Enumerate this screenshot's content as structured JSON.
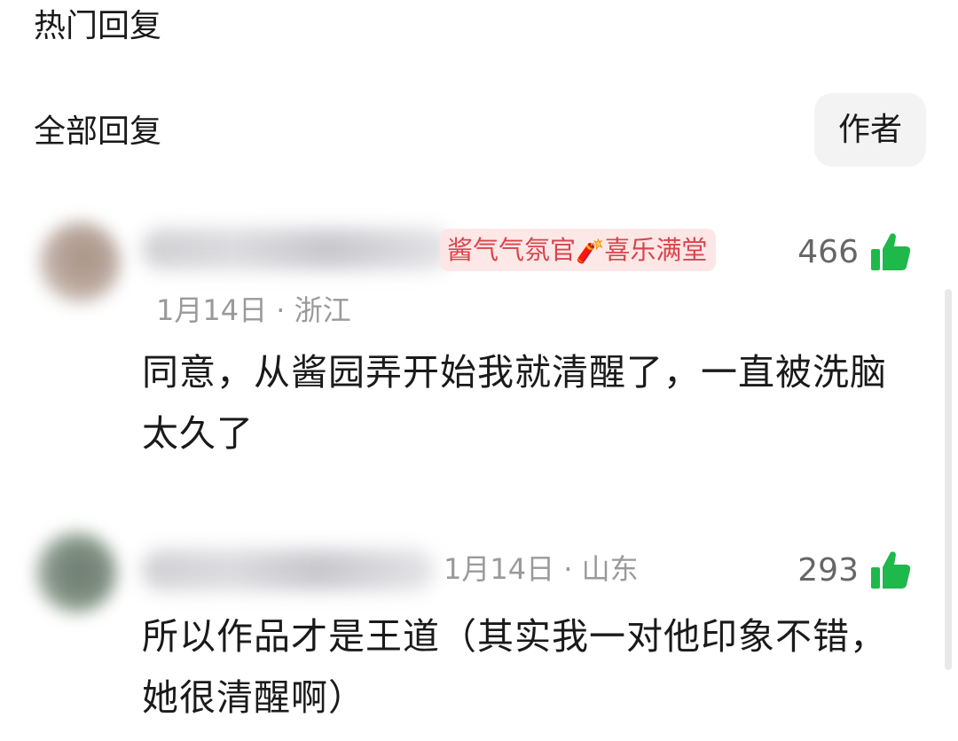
{
  "sections": {
    "hot_title": "热门回复",
    "all_title": "全部回复",
    "author_filter": "作者"
  },
  "comments": [
    {
      "badge": {
        "prefix": "酱气气氛官",
        "icon_name": "firecracker-icon",
        "icon": "🧨",
        "suffix": "喜乐满堂"
      },
      "likes": "466",
      "meta": "1月14日 · 浙江",
      "text": "同意，从酱园弄开始我就清醒了，一直被洗脑太久了"
    },
    {
      "likes": "293",
      "meta": "1月14日 · 山东",
      "text": "所以作品才是王道（其实我一对他印象不错，她很清醒啊）"
    }
  ],
  "colors": {
    "like_green": "#1fb84a",
    "badge_red": "#d9454d",
    "badge_bg": "#fde8e8",
    "meta_gray": "#9a9a9a"
  },
  "icons": {
    "like": "thumbs-up-icon"
  }
}
